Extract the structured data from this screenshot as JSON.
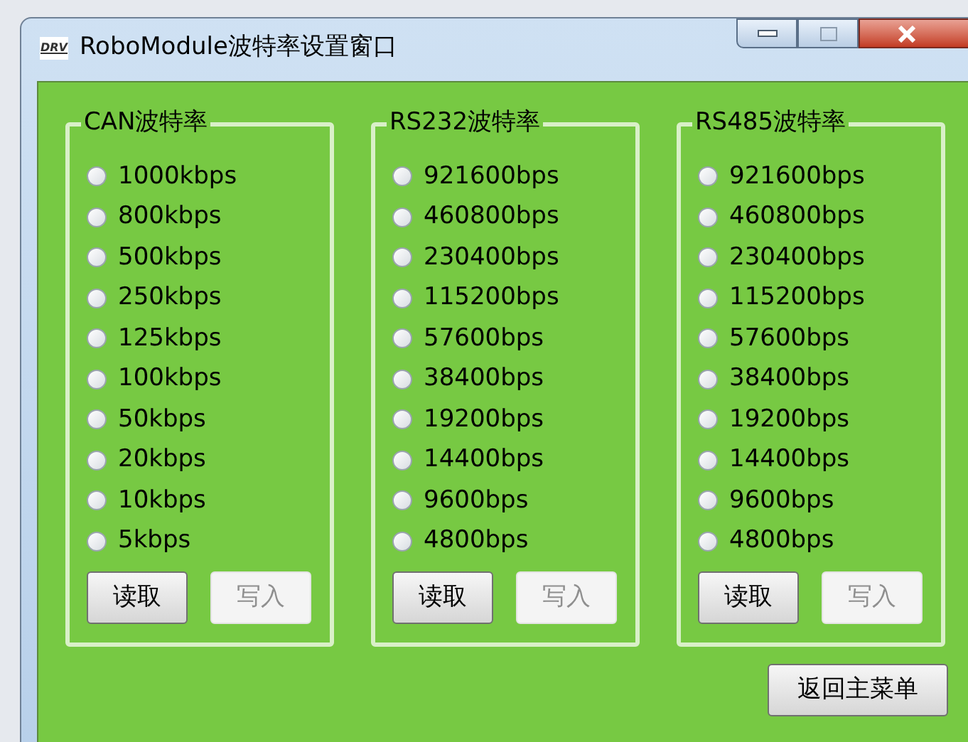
{
  "window": {
    "logo": "DRV",
    "title": "RoboModule波特率设置窗口"
  },
  "groups": [
    {
      "title": "CAN波特率",
      "options": [
        {
          "label": "1000kbps",
          "selected": false
        },
        {
          "label": "800kbps",
          "selected": false
        },
        {
          "label": "500kbps",
          "selected": false
        },
        {
          "label": "250kbps",
          "selected": false
        },
        {
          "label": "125kbps",
          "selected": false
        },
        {
          "label": "100kbps",
          "selected": false
        },
        {
          "label": "50kbps",
          "selected": false
        },
        {
          "label": "20kbps",
          "selected": false
        },
        {
          "label": "10kbps",
          "selected": false
        },
        {
          "label": "5kbps",
          "selected": false
        }
      ],
      "buttons": [
        {
          "label": "读取",
          "disabled": false
        },
        {
          "label": "写入",
          "disabled": true
        }
      ]
    },
    {
      "title": "RS232波特率",
      "options": [
        {
          "label": "921600bps",
          "selected": false
        },
        {
          "label": "460800bps",
          "selected": false
        },
        {
          "label": "230400bps",
          "selected": false
        },
        {
          "label": "115200bps",
          "selected": false
        },
        {
          "label": "57600bps",
          "selected": false
        },
        {
          "label": "38400bps",
          "selected": false
        },
        {
          "label": "19200bps",
          "selected": false
        },
        {
          "label": "14400bps",
          "selected": false
        },
        {
          "label": "9600bps",
          "selected": false
        },
        {
          "label": "4800bps",
          "selected": false
        }
      ],
      "buttons": [
        {
          "label": "读取",
          "disabled": false
        },
        {
          "label": "写入",
          "disabled": true
        }
      ]
    },
    {
      "title": "RS485波特率",
      "options": [
        {
          "label": "921600bps",
          "selected": false
        },
        {
          "label": "460800bps",
          "selected": false
        },
        {
          "label": "230400bps",
          "selected": false
        },
        {
          "label": "115200bps",
          "selected": false
        },
        {
          "label": "57600bps",
          "selected": false
        },
        {
          "label": "38400bps",
          "selected": false
        },
        {
          "label": "19200bps",
          "selected": false
        },
        {
          "label": "14400bps",
          "selected": false
        },
        {
          "label": "9600bps",
          "selected": false
        },
        {
          "label": "4800bps",
          "selected": false
        }
      ],
      "buttons": [
        {
          "label": "读取",
          "disabled": false
        },
        {
          "label": "写入",
          "disabled": true
        }
      ]
    }
  ],
  "back_button": "返回主菜单"
}
